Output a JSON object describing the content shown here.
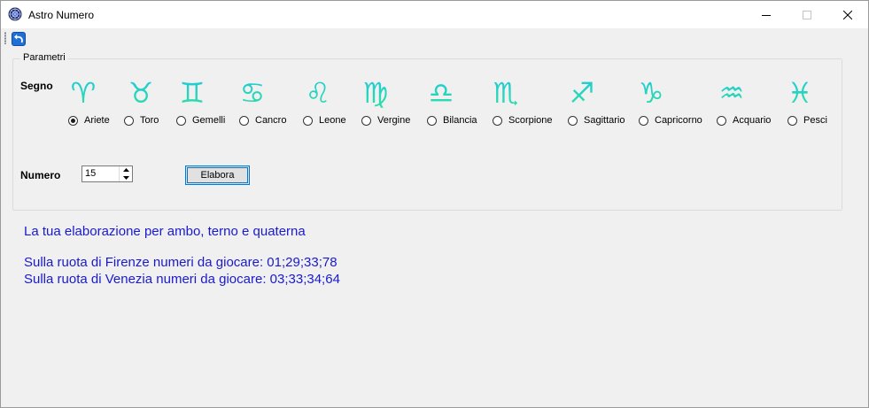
{
  "window": {
    "title": "Astro Numero"
  },
  "icons": {
    "app": "astro-wheel-icon",
    "back": "undo-arrow-icon",
    "minimize": "minimize-icon",
    "maximize": "maximize-icon",
    "close": "close-icon"
  },
  "colors": {
    "accent": "#0078d7",
    "result_text": "#1a1acd",
    "sign_gradient_top": "#1ec8dc",
    "sign_gradient_bottom": "#2fe0a0"
  },
  "params": {
    "legend": "Parametri",
    "segno_label": "Segno",
    "numero_label": "Numero",
    "numero_value": "15",
    "elabora_label": "Elabora",
    "selected_sign": "Ariete",
    "signs": [
      {
        "name": "Ariete",
        "glyph": "♈",
        "icon": "aries-icon"
      },
      {
        "name": "Toro",
        "glyph": "♉",
        "icon": "taurus-icon"
      },
      {
        "name": "Gemelli",
        "glyph": "♊",
        "icon": "gemini-icon"
      },
      {
        "name": "Cancro",
        "glyph": "♋",
        "icon": "cancer-icon"
      },
      {
        "name": "Leone",
        "glyph": "♌",
        "icon": "leo-icon"
      },
      {
        "name": "Vergine",
        "glyph": "♍",
        "icon": "virgo-icon"
      },
      {
        "name": "Bilancia",
        "glyph": "♎",
        "icon": "libra-icon"
      },
      {
        "name": "Scorpione",
        "glyph": "♏",
        "icon": "scorpio-icon"
      },
      {
        "name": "Sagittario",
        "glyph": "♐",
        "icon": "sagittarius-icon"
      },
      {
        "name": "Capricorno",
        "glyph": "♑",
        "icon": "capricorn-icon"
      },
      {
        "name": "Acquario",
        "glyph": "♒",
        "icon": "aquarius-icon"
      },
      {
        "name": "Pesci",
        "glyph": "♓",
        "icon": "pisces-icon"
      }
    ]
  },
  "results": {
    "heading": "La tua elaborazione per ambo, terno e quaterna",
    "lines": [
      "Sulla ruota di Firenze numeri da giocare: 01;29;33;78",
      "Sulla ruota di Venezia numeri da giocare: 03;33;34;64"
    ]
  }
}
